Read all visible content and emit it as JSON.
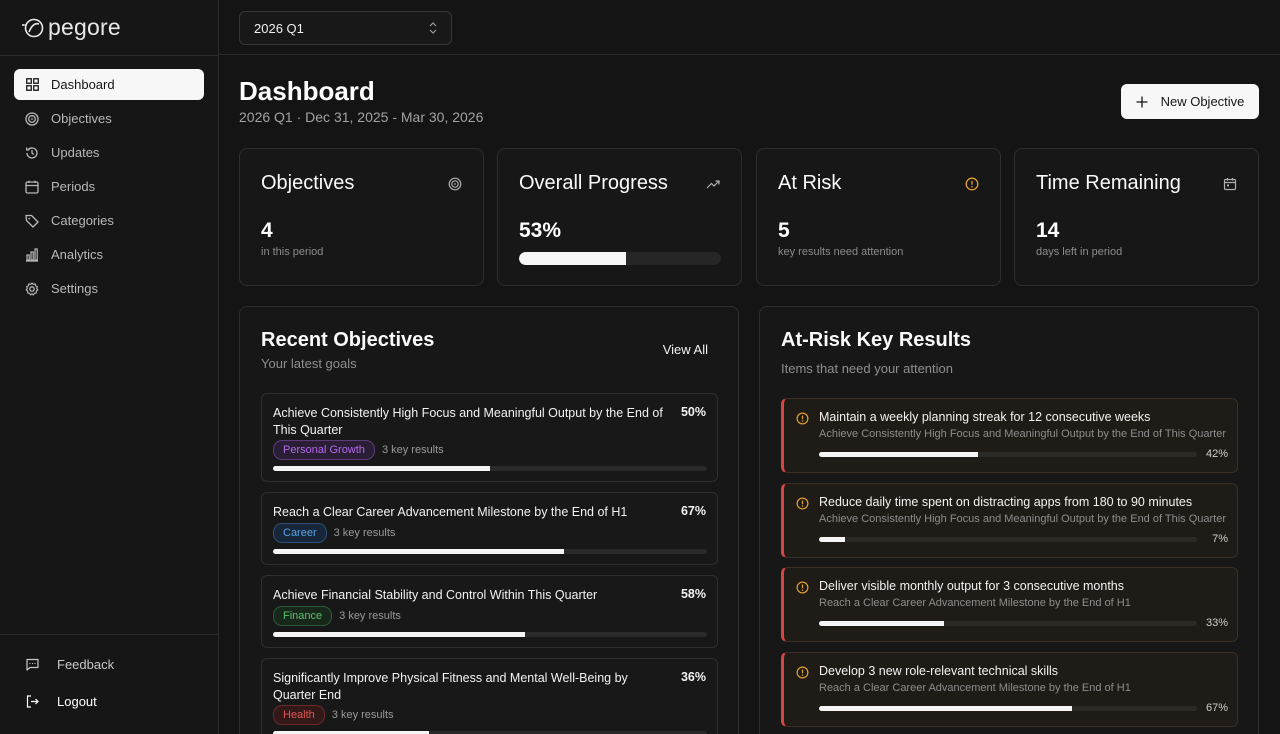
{
  "brand": {
    "name": "pegore"
  },
  "sidebar": {
    "items": [
      {
        "label": "Dashboard",
        "icon": "dashboard-grid-icon",
        "active": true
      },
      {
        "label": "Objectives",
        "icon": "target-icon"
      },
      {
        "label": "Updates",
        "icon": "history-icon"
      },
      {
        "label": "Periods",
        "icon": "calendar-icon"
      },
      {
        "label": "Categories",
        "icon": "tag-icon"
      },
      {
        "label": "Analytics",
        "icon": "bar-chart-icon"
      },
      {
        "label": "Settings",
        "icon": "gear-icon"
      }
    ],
    "feedback_label": "Feedback",
    "logout_label": "Logout"
  },
  "topbar": {
    "period_value": "2026 Q1"
  },
  "header": {
    "title": "Dashboard",
    "subtitle": "2026 Q1 · Dec 31, 2025 - Mar 30, 2026",
    "new_button_label": "New Objective"
  },
  "stats": {
    "objectives": {
      "title": "Objectives",
      "value": "4",
      "sub": "in this period",
      "icon": "target-icon"
    },
    "progress": {
      "title": "Overall Progress",
      "value": "53%",
      "fraction": 0.53,
      "icon": "trending-up-icon"
    },
    "at_risk": {
      "title": "At Risk",
      "value": "5",
      "sub": "key results need attention",
      "icon": "alert-circle-icon"
    },
    "time": {
      "title": "Time Remaining",
      "value": "14",
      "sub": "days left in period",
      "icon": "calendar-icon"
    }
  },
  "recent": {
    "title": "Recent Objectives",
    "subtitle": "Your latest goals",
    "view_all": "View All",
    "items": [
      {
        "title": "Achieve Consistently High Focus and Meaningful Output by the End of This Quarter",
        "pct": "50%",
        "progress": 0.5,
        "category": "Personal Growth",
        "kr": "3 key results"
      },
      {
        "title": "Reach a Clear Career Advancement Milestone by the End of H1",
        "pct": "67%",
        "progress": 0.67,
        "category": "Career",
        "kr": "3 key results"
      },
      {
        "title": "Achieve Financial Stability and Control Within This Quarter",
        "pct": "58%",
        "progress": 0.58,
        "category": "Finance",
        "kr": "3 key results"
      },
      {
        "title": "Significantly Improve Physical Fitness and Mental Well-Being by Quarter End",
        "pct": "36%",
        "progress": 0.36,
        "category": "Health",
        "kr": "3 key results"
      }
    ]
  },
  "at_risk": {
    "title": "At-Risk Key Results",
    "subtitle": "Items that need your attention",
    "items": [
      {
        "title": "Maintain a weekly planning streak for 12 consecutive weeks",
        "parent": "Achieve Consistently High Focus and Meaningful Output by the End of This Quarter",
        "pct": "42%",
        "progress": 0.42
      },
      {
        "title": "Reduce daily time spent on distracting apps from 180 to 90 minutes",
        "parent": "Achieve Consistently High Focus and Meaningful Output by the End of This Quarter",
        "pct": "7%",
        "progress": 0.07
      },
      {
        "title": "Deliver visible monthly output for 3 consecutive months",
        "parent": "Reach a Clear Career Advancement Milestone by the End of H1",
        "pct": "33%",
        "progress": 0.33
      },
      {
        "title": "Develop 3 new role-relevant technical skills",
        "parent": "Reach a Clear Career Advancement Milestone by the End of H1",
        "pct": "67%",
        "progress": 0.67
      }
    ]
  },
  "colors": {
    "accent": "#f5f5f5",
    "risk_border": "#d94545",
    "warning": "#e0a030",
    "tag_personal_growth": "#b46be8",
    "tag_career": "#5aa0e6",
    "tag_finance": "#5bc26e",
    "tag_health": "#e05555"
  }
}
